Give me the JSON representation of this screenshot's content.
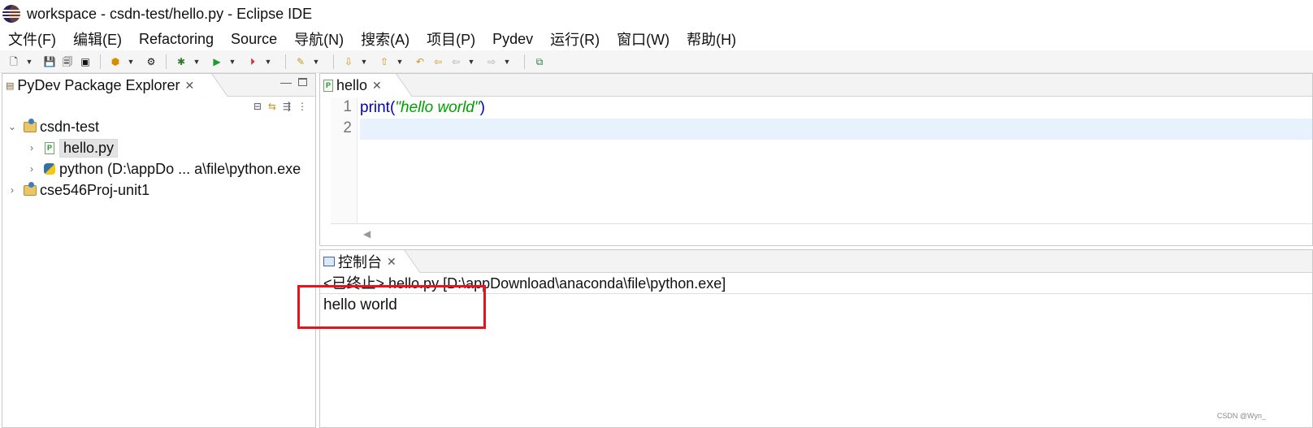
{
  "window": {
    "title": "workspace - csdn-test/hello.py - Eclipse IDE"
  },
  "menu": [
    "文件(F)",
    "编辑(E)",
    "Refactoring",
    "Source",
    "导航(N)",
    "搜索(A)",
    "项目(P)",
    "Pydev",
    "运行(R)",
    "窗口(W)",
    "帮助(H)"
  ],
  "explorer": {
    "title": "PyDev Package Explorer",
    "tree": [
      {
        "label": "csdn-test",
        "expanded": true
      },
      {
        "label": "hello.py",
        "selected": true
      },
      {
        "label": "python  (D:\\appDo ... a\\file\\python.exe"
      },
      {
        "label": "cse546Proj-unit1",
        "expanded": false
      }
    ]
  },
  "editor": {
    "tab": "hello",
    "lines": [
      {
        "number": "1",
        "func": "print(",
        "string": "\"hello world\"",
        "close": ")"
      },
      {
        "number": "2",
        "text": ""
      }
    ]
  },
  "console": {
    "tab": "控制台",
    "status": "<已终止> hello.py [D:\\appDownload\\anaconda\\file\\python.exe]",
    "output": "hello world"
  },
  "watermark": "CSDN @Wyn_",
  "colors": {
    "highlight": "#e8141c",
    "keyword": "#0000c0",
    "string": "#00a000",
    "current_line": "#e8f2fe"
  }
}
